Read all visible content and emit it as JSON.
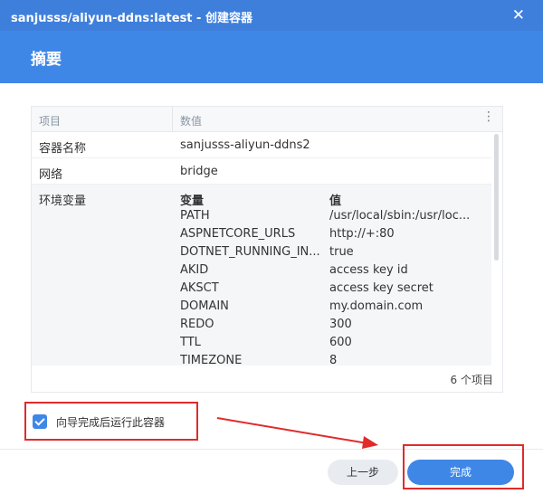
{
  "window": {
    "title": "sanjusss/aliyun-ddns:latest - 创建容器"
  },
  "header": {
    "title": "摘要"
  },
  "table": {
    "columns": [
      "项目",
      "数值"
    ],
    "rows": [
      {
        "key": "容器名称",
        "value": "sanjusss-aliyun-ddns2"
      },
      {
        "key": "网络",
        "value": "bridge"
      }
    ],
    "env": {
      "key": "环境变量",
      "col_var": "变量",
      "col_val": "值",
      "vars": [
        {
          "name": "PATH",
          "value": "/usr/local/sbin:/usr/loc..."
        },
        {
          "name": "ASPNETCORE_URLS",
          "value": "http://+:80"
        },
        {
          "name": "DOTNET_RUNNING_IN...",
          "value": "true"
        },
        {
          "name": "AKID",
          "value": "access key id"
        },
        {
          "name": "AKSCT",
          "value": "access key secret"
        },
        {
          "name": "DOMAIN",
          "value": "my.domain.com"
        },
        {
          "name": "REDO",
          "value": "300"
        },
        {
          "name": "TTL",
          "value": "600"
        },
        {
          "name": "TIMEZONE",
          "value": "8"
        }
      ]
    },
    "count": "6 个项目"
  },
  "options": {
    "run_after_label": "向导完成后运行此容器",
    "run_after_checked": true
  },
  "buttons": {
    "back": "上一步",
    "done": "完成"
  },
  "annotation_color": "#e02b2b",
  "accent_color": "#3f87e6"
}
